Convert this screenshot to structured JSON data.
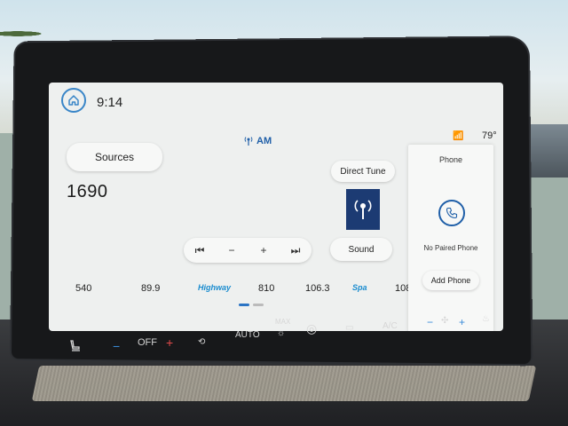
{
  "status": {
    "time": "9:14",
    "temperature": "79°"
  },
  "radio": {
    "band": "AM",
    "frequency": "1690",
    "sources_label": "Sources",
    "direct_tune_label": "Direct Tune",
    "sound_label": "Sound",
    "controls": [
      "⏮",
      "−",
      "+",
      "⏭"
    ],
    "presets": [
      "540",
      "89.9",
      "Highway",
      "810",
      "106.3",
      "Spa",
      "108"
    ]
  },
  "phone": {
    "title": "Phone",
    "status": "No Paired Phone",
    "add_label": "Add Phone"
  },
  "climate": {
    "fan_state": "OFF",
    "auto_label": "AUTO",
    "max_label": "MAX",
    "ac_label": "A/C"
  },
  "colors": {
    "accent": "#2b74c4",
    "tile": "#1c3b73",
    "screen_bg": "#eef0ef"
  }
}
